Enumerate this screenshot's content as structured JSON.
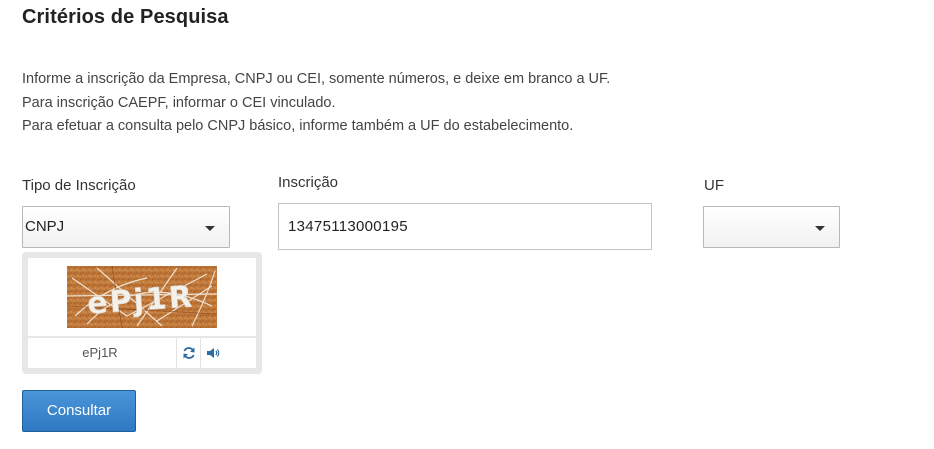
{
  "page": {
    "title": "Critérios de Pesquisa"
  },
  "instructions": [
    "Informe a inscrição da Empresa, CNPJ ou CEI, somente números, e deixe em branco a UF.",
    "Para inscrição CAEPF, informar o CEI vinculado.",
    "Para efetuar a consulta pelo CNPJ básico, informe também a UF do estabelecimento."
  ],
  "form": {
    "tipo_inscricao": {
      "label": "Tipo de Inscrição",
      "value": "CNPJ",
      "icon": "chevron-down-icon"
    },
    "inscricao": {
      "label": "Inscrição",
      "value": "13475113000195"
    },
    "uf": {
      "label": "UF",
      "value": "",
      "icon": "chevron-down-icon"
    }
  },
  "captcha": {
    "image_text": "ePj1R",
    "answer": "ePj1R",
    "refresh_icon": "refresh-icon",
    "audio_icon": "speaker-icon",
    "image_colors": {
      "background": "#c0783a",
      "text": "#f4f0ea"
    }
  },
  "actions": {
    "submit_label": "Consultar"
  }
}
